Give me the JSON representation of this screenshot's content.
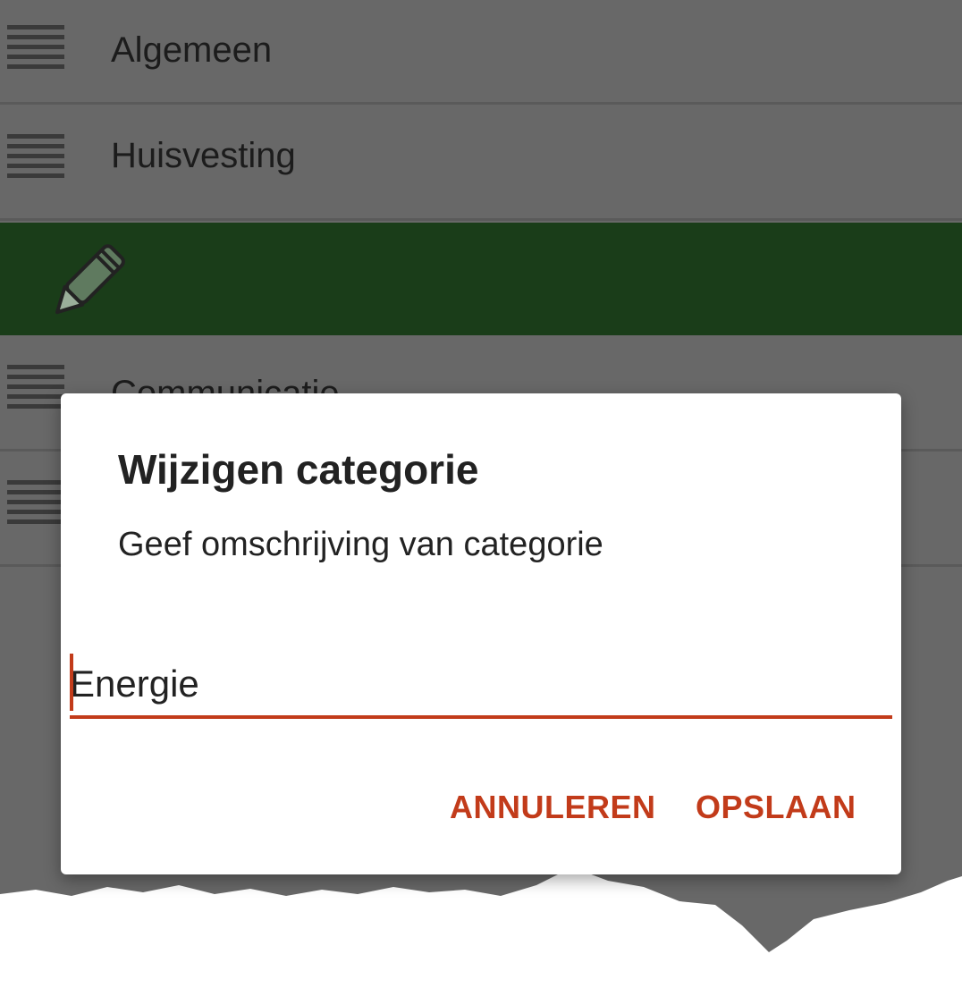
{
  "list": {
    "items": [
      {
        "label": "Algemeen"
      },
      {
        "label": "Huisvesting"
      },
      {
        "label": "Communicatie"
      },
      {
        "label": ""
      }
    ],
    "edit_row_color": "#1a3d19"
  },
  "dialog": {
    "title": "Wijzigen categorie",
    "message": "Geef omschrijving van categorie",
    "input_value": "Energie",
    "cancel_label": "ANNULEREN",
    "save_label": "OPSLAAN",
    "accent_color": "#c23b1a"
  },
  "icons": {
    "drag_handle": "drag-handle-icon",
    "edit": "pencil-icon"
  }
}
